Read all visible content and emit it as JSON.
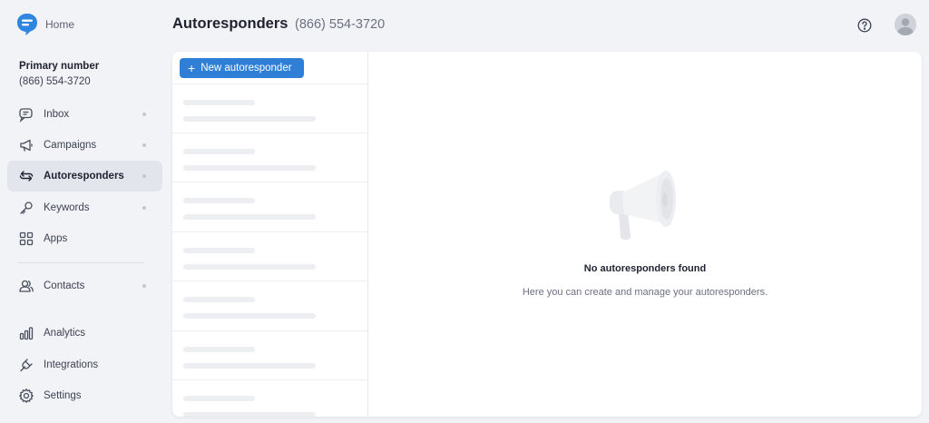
{
  "sidebar": {
    "home_label": "Home",
    "primary_label": "Primary number",
    "primary_number": "(866) 554-3720",
    "items": [
      {
        "label": "Inbox",
        "icon": "inbox-icon",
        "dot": true
      },
      {
        "label": "Campaigns",
        "icon": "megaphone-icon",
        "dot": true
      },
      {
        "label": "Autoresponders",
        "icon": "autoresponder-icon",
        "dot": true,
        "active": true
      },
      {
        "label": "Keywords",
        "icon": "key-icon",
        "dot": true
      },
      {
        "label": "Apps",
        "icon": "apps-grid-icon",
        "dot": false
      },
      {
        "label": "Contacts",
        "icon": "contacts-icon",
        "dot": true
      },
      {
        "label": "Analytics",
        "icon": "analytics-icon",
        "dot": false
      },
      {
        "label": "Integrations",
        "icon": "plug-icon",
        "dot": false
      },
      {
        "label": "Settings",
        "icon": "gear-icon",
        "dot": false
      }
    ]
  },
  "header": {
    "title": "Autoresponders",
    "subtitle": "(866) 554-3720",
    "help_icon": "help-icon",
    "avatar_icon": "user-avatar-icon"
  },
  "list": {
    "new_button_label": "New autoresponder",
    "placeholder_rows": 7
  },
  "empty_state": {
    "icon": "megaphone-illustration",
    "title": "No autoresponders found",
    "description": "Here you can create and manage your autoresponders."
  },
  "colors": {
    "accent": "#2f7fd6",
    "background": "#f1f3f6",
    "active_nav": "#e2e6ec"
  }
}
